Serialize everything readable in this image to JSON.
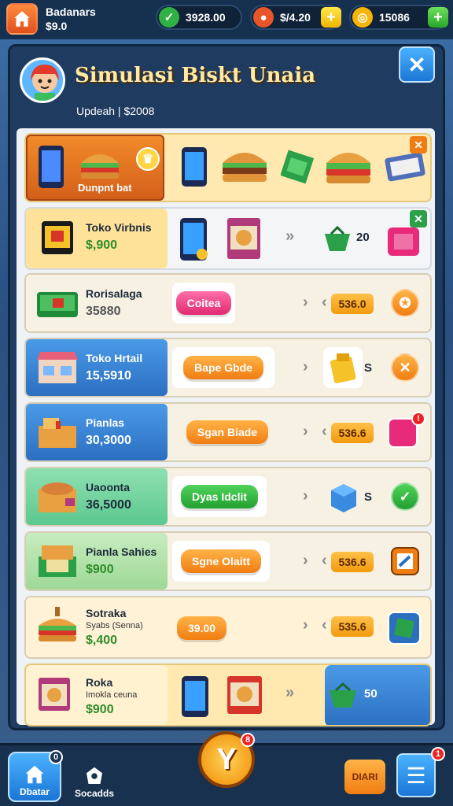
{
  "hud": {
    "player_name": "Badanars",
    "player_cash": "$9.0",
    "res1_value": "3928.00",
    "res2_value": "$/4.20",
    "res3_value": "15086"
  },
  "panel": {
    "title": "Simulasi Biskt Unaia",
    "subline": "Updeah  |  $2008",
    "close_label": "✕"
  },
  "rows": [
    {
      "name": "Dunpnt bat",
      "price": ""
    },
    {
      "name": "Toko Virbnis",
      "price": "$,900",
      "right_count": "20"
    },
    {
      "name": "Rorisalaga",
      "price": "35880",
      "action": "Coitea",
      "tag": "536.0"
    },
    {
      "name": "Toko Hrtail",
      "price": "15,5910",
      "action": "Bape Gbde",
      "right_text": "S"
    },
    {
      "name": "Pianlas",
      "price": "30,3000",
      "action": "Sgan Biade",
      "tag": "536.6"
    },
    {
      "name": "Uaoonta",
      "price": "36,5000",
      "action": "Dyas Idclit",
      "right_text": "S"
    },
    {
      "name": "Pianla Sahies",
      "price": "$900",
      "action": "Sgne Olaitt",
      "tag": "536.6"
    },
    {
      "name": "Sotraka",
      "sub": "Syabs (Senna)",
      "price": "$,400",
      "pill": "39.00",
      "tag": "535.6"
    },
    {
      "name": "Roka",
      "sub": "Imokla ceuna",
      "price": "$900",
      "right_count": "50"
    }
  ],
  "bottom": {
    "home_label": "Dbatar",
    "second_label": "Socadds",
    "center_label": "Y",
    "shop_label": "DIARI",
    "home_badge": "0",
    "center_badge": "8",
    "menu_badge": "1"
  },
  "colors": {
    "accent_orange": "#f07d12",
    "accent_blue": "#1b76d6",
    "accent_green": "#23a030",
    "accent_pink": "#e02a72"
  }
}
